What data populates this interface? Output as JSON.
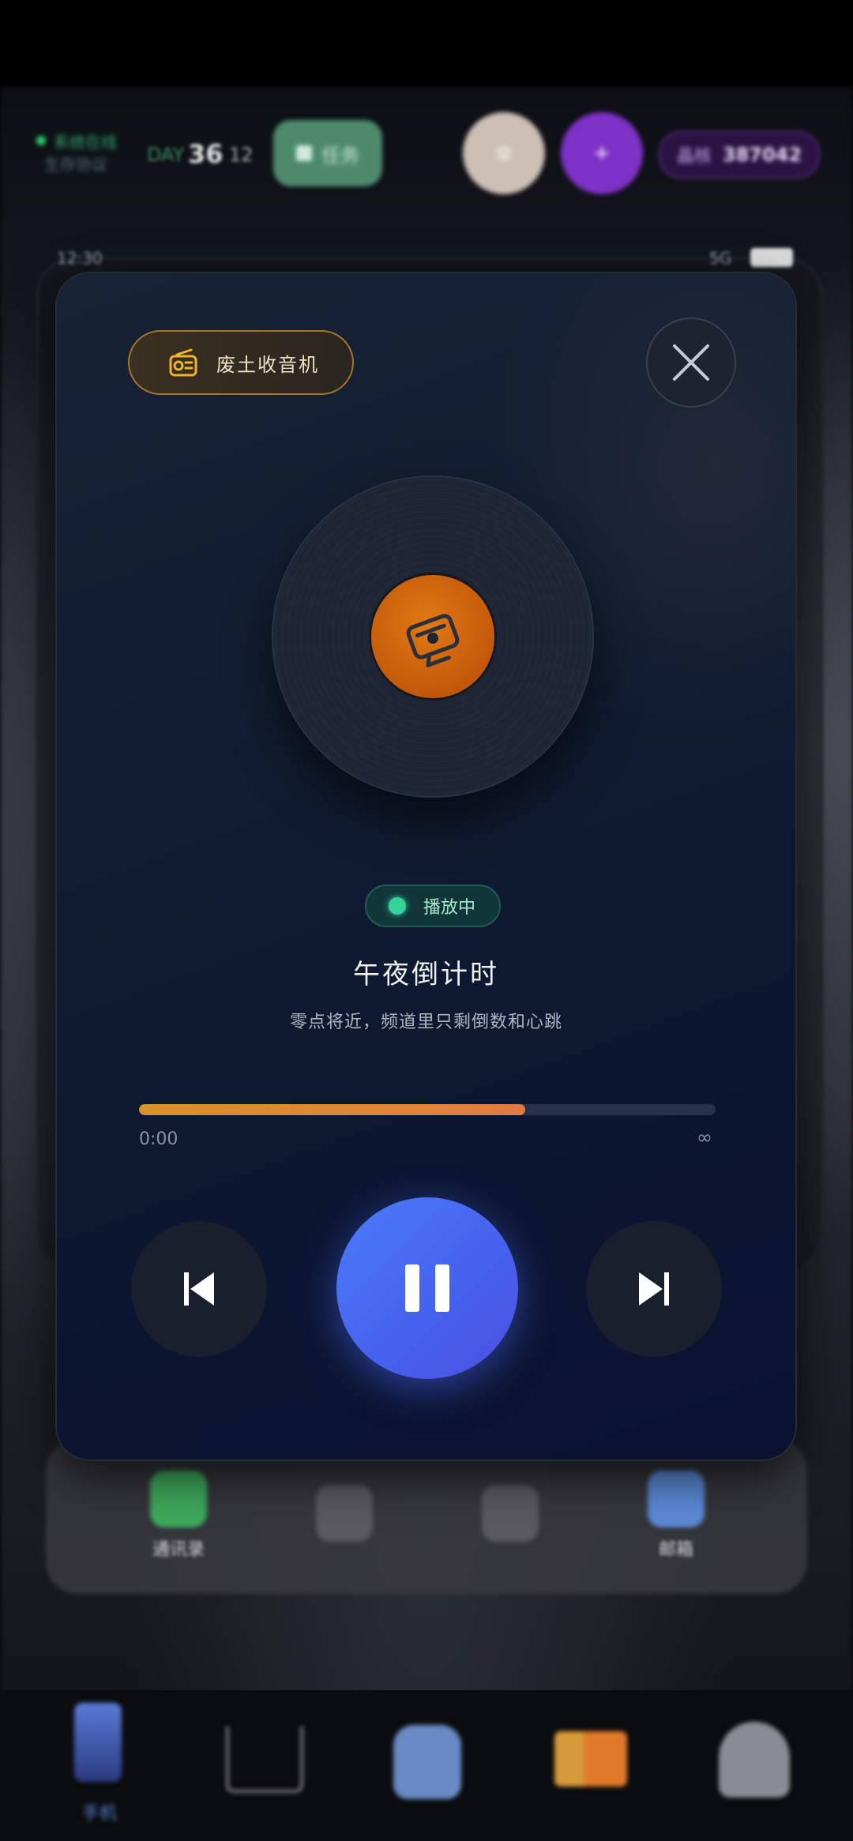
{
  "top_bar": {
    "status_text": "系统在线",
    "sub_text": "生存协议",
    "day_label": "DAY",
    "day_number": "36",
    "hour": "12",
    "task_label": "任务",
    "avatar_a_text": "伞",
    "avatar_b_text": "+",
    "currency_label": "晶核",
    "currency_value": "387042"
  },
  "phone": {
    "time": "12:30",
    "network": "5G"
  },
  "radio": {
    "badge_label": "废土收音机",
    "status": "播放中",
    "title": "午夜倒计时",
    "description": "零点将近，频道里只剩倒数和心跳",
    "progress": 0.67,
    "time_start": "0:00",
    "time_end": "∞",
    "accent_color": "#e07a14",
    "play_button_color": "#4a6cf0"
  },
  "dock": {
    "apps": [
      {
        "label": "通讯录",
        "color": "#3daa5c"
      },
      {
        "label": "",
        "color": "#5a5a5e"
      },
      {
        "label": "",
        "color": "#5a5a5e"
      },
      {
        "label": "邮箱",
        "color": "#5b8ad6"
      }
    ]
  },
  "bottom_nav": {
    "items": [
      {
        "label": "手机",
        "icon": "phone-icon"
      },
      {
        "label": "",
        "icon": "cart-icon"
      },
      {
        "label": "",
        "icon": "backpack-icon"
      },
      {
        "label": "",
        "icon": "truck-icon"
      },
      {
        "label": "",
        "icon": "person-icon"
      }
    ]
  }
}
